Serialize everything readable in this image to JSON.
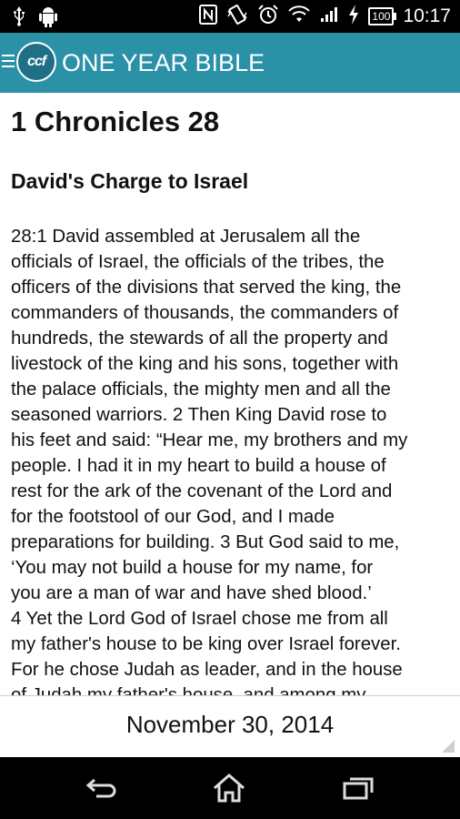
{
  "status_bar": {
    "time": "10:17",
    "battery": "100",
    "icons_left": [
      "usb-icon",
      "android-icon"
    ],
    "icons_right": [
      "nfc-icon",
      "vibrate-icon",
      "alarm-icon",
      "wifi-icon",
      "signal-icon",
      "charging-icon",
      "battery-icon"
    ]
  },
  "app_bar": {
    "logo_text": "ccf",
    "title": "ONE YEAR BIBLE",
    "color": "#2a91a7"
  },
  "reading": {
    "chapter_title": "1 Chronicles 28",
    "section_title": "David's Charge to Israel",
    "lines": [
      "28:1 David assembled at Jerusalem all the",
      "officials of Israel, the officials of the tribes, the",
      "officers of the divisions that served the king, the",
      "commanders of thousands, the commanders of",
      "hundreds, the stewards of all the property and",
      "livestock of the king and his sons, together with",
      "the palace officials, the mighty men and all the",
      "seasoned warriors. 2 Then King David rose to",
      "his feet and said: “Hear me, my brothers and my",
      "people. I had it in my heart to build a house of",
      "rest for the ark of the covenant of the Lord and",
      "for the footstool of our God, and I made",
      "preparations for building. 3 But God said to me,",
      "‘You may not build a house for my name, for",
      "you are a man of war and have shed blood.’",
      "4 Yet the Lord God of Israel chose me from all",
      "my father's house to be king over Israel forever.",
      "For he chose Judah as leader, and in the house",
      "of Judah my father's house, and among my"
    ]
  },
  "footer": {
    "date": "November 30, 2014"
  },
  "nav_bar": {
    "buttons": [
      "back-icon",
      "home-icon",
      "recent-apps-icon"
    ]
  }
}
